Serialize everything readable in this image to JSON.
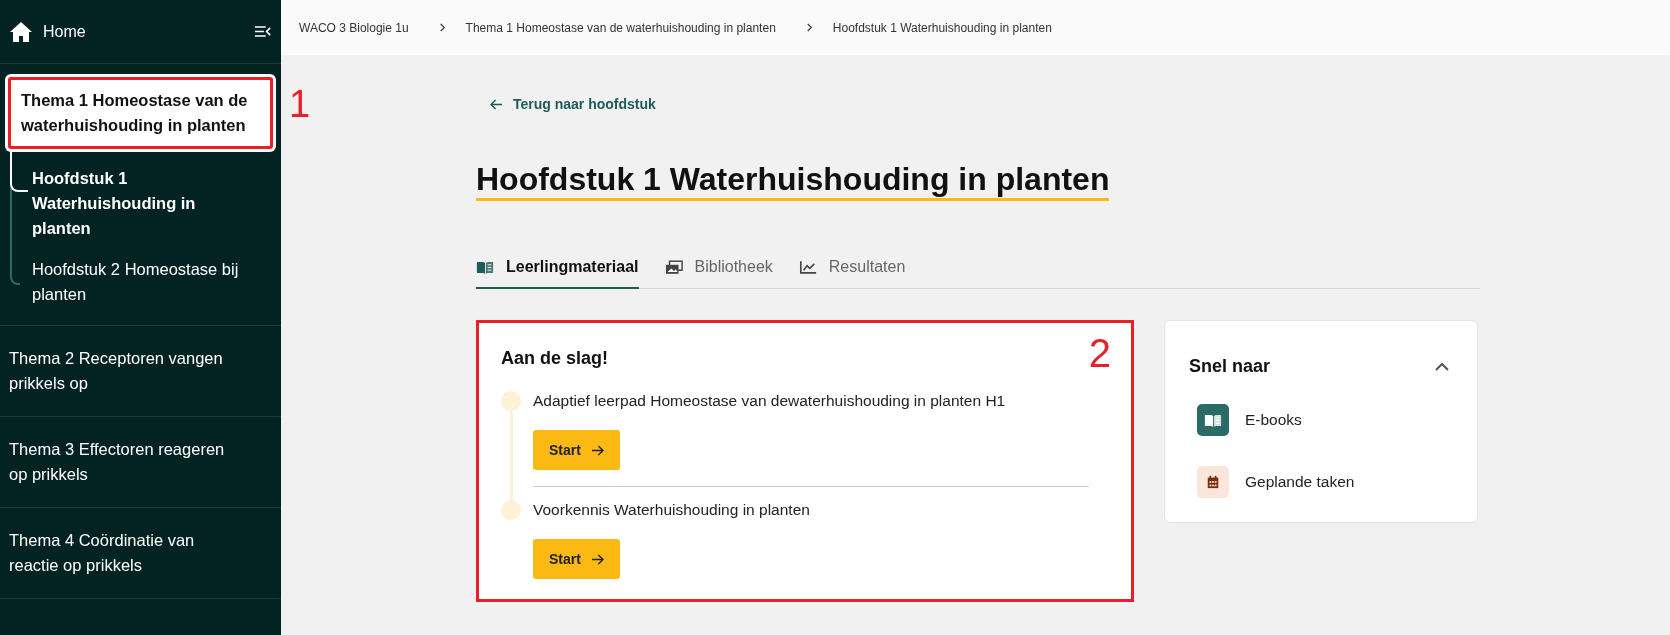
{
  "sidebar": {
    "home": "Home",
    "items": [
      {
        "label": "Thema 1 Homeostase van de waterhuishouding in planten",
        "selected": true,
        "annotation": "1",
        "children": [
          {
            "label": "Hoofdstuk 1 Waterhuishouding in planten",
            "selected": true
          },
          {
            "label": "Hoofdstuk 2 Homeostase bij planten",
            "selected": false
          }
        ]
      },
      {
        "label": "Thema 2 Receptoren vangen prikkels op",
        "selected": false
      },
      {
        "label": "Thema 3 Effectoren reageren op prikkels",
        "selected": false
      },
      {
        "label": "Thema 4 Coördinatie van reactie op prikkels",
        "selected": false
      }
    ]
  },
  "breadcrumb": [
    "WACO 3 Biologie 1u",
    "Thema 1 Homeostase van de waterhuishouding in planten",
    "Hoofdstuk 1 Waterhuishouding in planten"
  ],
  "back_link": "Terug naar hoofdstuk",
  "title": "Hoofdstuk 1 Waterhuishouding in planten",
  "tabs": [
    {
      "label": "Leerlingmateriaal",
      "kind": "book",
      "selected": true
    },
    {
      "label": "Bibliotheek",
      "kind": "images",
      "selected": false
    },
    {
      "label": "Resultaten",
      "kind": "chart",
      "selected": false
    }
  ],
  "start_card": {
    "title": "Aan de slag!",
    "annotation": "2",
    "items": [
      {
        "label": "Adaptief leerpad Homeostase van dewaterhuishouding in planten H1",
        "button": "Start"
      },
      {
        "label": "Voorkennis Waterhuishouding in planten",
        "button": "Start"
      }
    ]
  },
  "quick_links": {
    "title": "Snel naar",
    "expanded": true,
    "items": [
      {
        "label": "E-books",
        "kind": "book"
      },
      {
        "label": "Geplande taken",
        "kind": "calendar"
      }
    ]
  }
}
